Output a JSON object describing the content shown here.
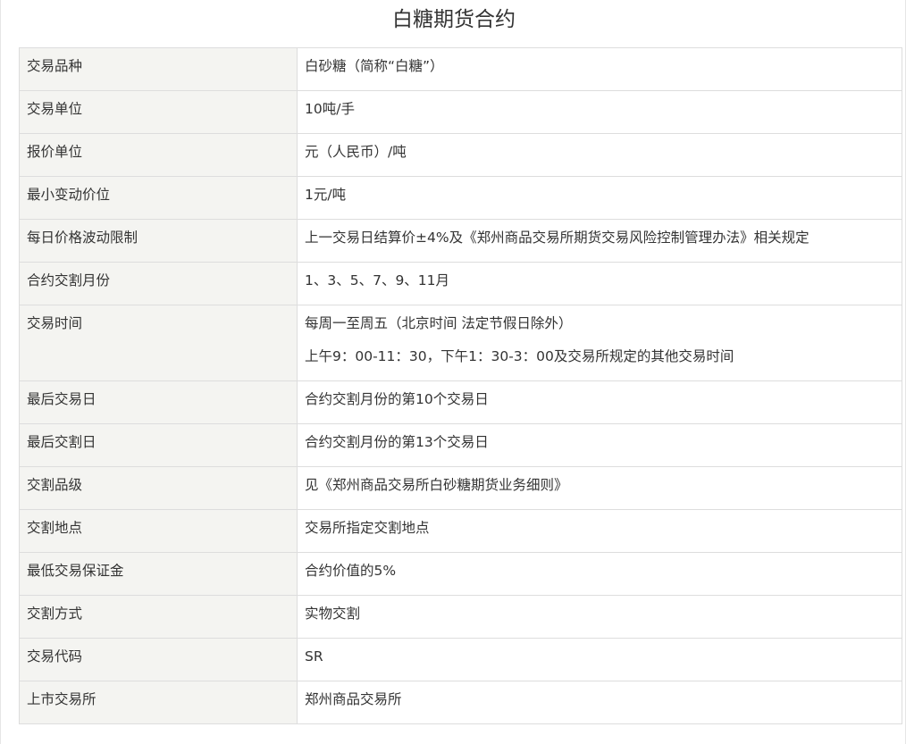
{
  "title": "白糖期货合约",
  "rows": [
    {
      "label": "交易品种",
      "value": "白砂糖（简称“白糖”）"
    },
    {
      "label": "交易单位",
      "value": "10吨/手"
    },
    {
      "label": "报价单位",
      "value": "元（人民币）/吨"
    },
    {
      "label": "最小变动价位",
      "value": "1元/吨"
    },
    {
      "label": "每日价格波动限制",
      "value": "上一交易日结算价±4%及《郑州商品交易所期货交易风险控制管理办法》相关规定"
    },
    {
      "label": "合约交割月份",
      "value": "1、3、5、7、9、11月"
    },
    {
      "label": "交易时间",
      "value": "每周一至周五（北京时间 法定节假日除外）",
      "value2": "上午9：00-11：30，下午1：30-3：00及交易所规定的其他交易时间"
    },
    {
      "label": "最后交易日",
      "value": "合约交割月份的第10个交易日"
    },
    {
      "label": "最后交割日",
      "value": "合约交割月份的第13个交易日"
    },
    {
      "label": "交割品级",
      "value": "见《郑州商品交易所白砂糖期货业务细则》"
    },
    {
      "label": "交割地点",
      "value": "交易所指定交割地点"
    },
    {
      "label": "最低交易保证金",
      "value": "合约价值的5%"
    },
    {
      "label": "交割方式",
      "value": "实物交割"
    },
    {
      "label": "交易代码",
      "value": "SR"
    },
    {
      "label": "上市交易所",
      "value": "郑州商品交易所"
    }
  ]
}
